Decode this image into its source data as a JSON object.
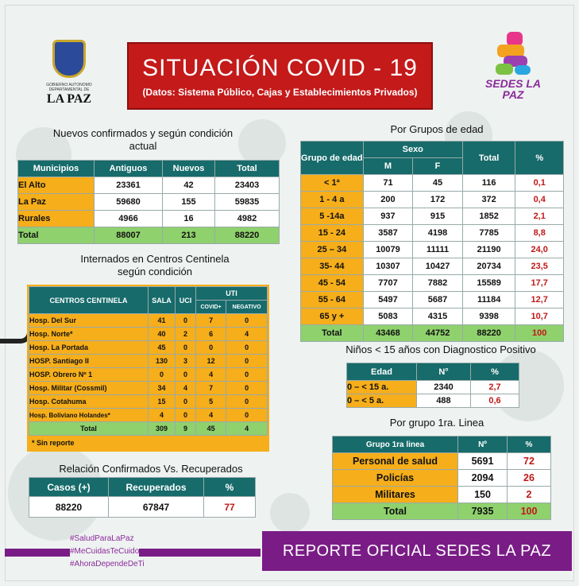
{
  "logo_left": {
    "small_text": "GOBIERNO AUTONOMO DEPARTAMENTAL DE",
    "name": "LA PAZ"
  },
  "logo_right": {
    "name": "SEDES LA PAZ"
  },
  "title": "SITUACIÓN  COVID - 19",
  "subtitle": "(Datos: Sistema Público, Cajas y Establecimientos Privados)",
  "muni": {
    "caption": "Nuevos confirmados y según condición actual",
    "headers": [
      "Municipios",
      "Antiguos",
      "Nuevos",
      "Total"
    ],
    "rows": [
      [
        "El Alto",
        "23361",
        "42",
        "23403"
      ],
      [
        "La Paz",
        "59680",
        "155",
        "59835"
      ],
      [
        "Rurales",
        "4966",
        "16",
        "4982"
      ]
    ],
    "total": [
      "Total",
      "88007",
      "213",
      "88220"
    ]
  },
  "centinela": {
    "caption": "Internados en Centros Centinela según condición",
    "headers": {
      "name": "CENTROS CENTINELA",
      "sala": "SALA",
      "uci": "UCI",
      "uti": "UTI",
      "covid": "COVID+",
      "neg": "NEGATIVO"
    },
    "rows": [
      [
        "Hosp. Del Sur",
        "41",
        "0",
        "7",
        "0"
      ],
      [
        "Hosp. Norte*",
        "40",
        "2",
        "6",
        "4"
      ],
      [
        "Hosp. La Portada",
        "45",
        "0",
        "0",
        "0"
      ],
      [
        "HOSP. Santiago II",
        "130",
        "3",
        "12",
        "0"
      ],
      [
        "HOSP. Obrero Nº 1",
        "0",
        "0",
        "4",
        "0"
      ],
      [
        "Hosp. Militar (Cossmil)",
        "34",
        "4",
        "7",
        "0"
      ],
      [
        "Hosp. Cotahuma",
        "15",
        "0",
        "5",
        "0"
      ],
      [
        "Hosp. Boliviano Holandes*",
        "4",
        "0",
        "4",
        "0"
      ]
    ],
    "total": [
      "Total",
      "309",
      "9",
      "45",
      "4"
    ],
    "note": "* Sin reporte"
  },
  "relacion": {
    "caption": "Relación Confirmados Vs. Recuperados",
    "headers": [
      "Casos (+)",
      "Recuperados",
      "%"
    ],
    "values": [
      "88220",
      "67847",
      "77"
    ]
  },
  "edad": {
    "caption": "Por Grupos de  edad",
    "headers": {
      "grupo": "Grupo de edad",
      "sexo": "Sexo",
      "m": "M",
      "f": "F",
      "total": "Total",
      "pct": "%"
    },
    "rows": [
      [
        "< 1ª",
        "71",
        "45",
        "116",
        "0,1"
      ],
      [
        "1 - 4 a",
        "200",
        "172",
        "372",
        "0,4"
      ],
      [
        "5 -14a",
        "937",
        "915",
        "1852",
        "2,1"
      ],
      [
        "15 - 24",
        "3587",
        "4198",
        "7785",
        "8,8"
      ],
      [
        "25 – 34",
        "10079",
        "11111",
        "21190",
        "24,0"
      ],
      [
        "35- 44",
        "10307",
        "10427",
        "20734",
        "23,5"
      ],
      [
        "45 - 54",
        "7707",
        "7882",
        "15589",
        "17,7"
      ],
      [
        "55 - 64",
        "5497",
        "5687",
        "11184",
        "12,7"
      ],
      [
        "65 y +",
        "5083",
        "4315",
        "9398",
        "10,7"
      ]
    ],
    "total": [
      "Total",
      "43468",
      "44752",
      "88220",
      "100"
    ]
  },
  "ninos": {
    "caption": "Niños < 15 años con Diagnostico Positivo",
    "headers": [
      "Edad",
      "N°",
      "%"
    ],
    "rows": [
      [
        "0 – < 15 a.",
        "2340",
        "2,7"
      ],
      [
        "0 – < 5 a.",
        "488",
        "0,6"
      ]
    ]
  },
  "linea": {
    "caption": "Por grupo 1ra. Linea",
    "headers": [
      "Grupo 1ra linea",
      "Nº",
      "%"
    ],
    "rows": [
      [
        "Personal de salud",
        "5691",
        "72"
      ],
      [
        "Policías",
        "2094",
        "26"
      ],
      [
        "Militares",
        "150",
        "2"
      ]
    ],
    "total": [
      "Total",
      "7935",
      "100"
    ]
  },
  "hashtags": [
    "#SaludParaLaPaz",
    "#MeCuidasTeCuido",
    "#AhoraDependeDeTi"
  ],
  "footer": "REPORTE OFICIAL SEDES LA PAZ",
  "colors": {
    "teal": "#176b6b",
    "orange": "#f6ae1a",
    "green": "#8fd16d",
    "red": "#c41a1a",
    "purple": "#7a1c86"
  }
}
